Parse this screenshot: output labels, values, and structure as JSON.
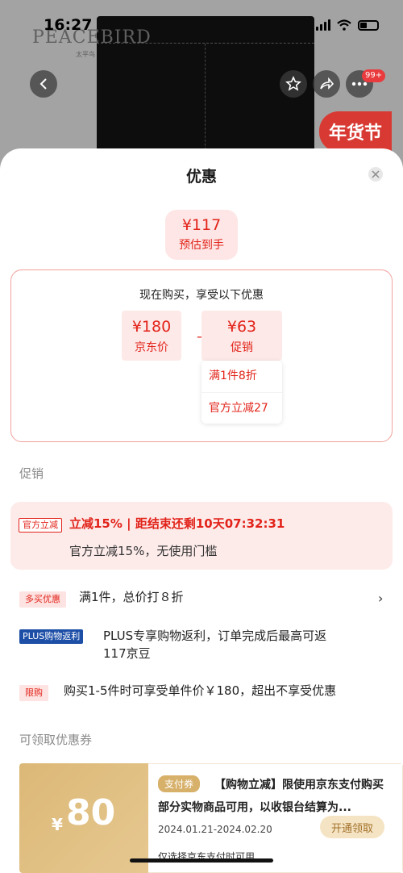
{
  "status_bar": {
    "time": "16:27"
  },
  "product_bg": {
    "brand": "PEACEBIRD",
    "brand_sub": "太平鸟",
    "cart_badge": "99+",
    "promo_tag": "年货节"
  },
  "sheet": {
    "title": "优惠",
    "estimate": {
      "price": "¥117",
      "label": "预估到手"
    },
    "breakdown": {
      "heading": "现在购买，享受以下优惠",
      "jd_price": {
        "price": "¥180",
        "label": "京东价"
      },
      "minus": "–",
      "discount": {
        "price": "¥63",
        "label": "促销"
      },
      "details": [
        "满1件8折",
        "官方立减27"
      ]
    },
    "promotions_label": "促销",
    "official": {
      "tag": "官方立减",
      "title": "立减15% | 距结束还剩10天07:32:31",
      "subtitle": "官方立减15%，无使用门槛"
    },
    "multi_buy": {
      "tag": "多买优惠",
      "text": "满1件，总价打８折"
    },
    "plus": {
      "tag": "PLUS购物返利",
      "text_line1": "PLUS专享购物返利，订单完成后最高可返",
      "text_line2": "117京豆"
    },
    "limit": {
      "tag": "限购",
      "text": "购买1-5件时可享受单件价￥180，超出不享受优惠"
    },
    "coupons_label": "可领取优惠券",
    "coupon": {
      "currency": "¥",
      "amount": "80",
      "pay_tag": "支付券",
      "description": "【购物立减】限使用京东支付购买部分实物商品可用，以收银台结算为...",
      "date": "2024.01.21-2024.02.20",
      "button": "开通领取",
      "note": "仅选择京东支付时可用"
    }
  },
  "colors": {
    "accent_red": "#e2231a",
    "soft_red": "#fde9e8",
    "gold": "#dcb877",
    "plus_blue": "#1d4fa7"
  }
}
